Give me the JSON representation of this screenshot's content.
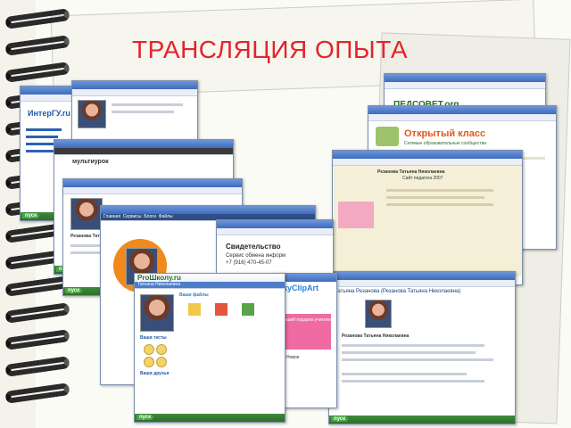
{
  "slide": {
    "title": "ТРАНСЛЯЦИЯ ОПЫТА"
  },
  "colors": {
    "title": "#e3242b",
    "taskbar": "#2c6d2a",
    "window_title": "#3d6bbf",
    "skyclip": "#2a7fd4",
    "open_class": "#e05a1c"
  },
  "screens": {
    "intergu": {
      "logo": "ИнтерГУ.ru",
      "start": "пуск"
    },
    "multiurok": {
      "logo": "мультиурок",
      "start": "пуск"
    },
    "profile": {
      "name": "Резанова Татьяна Николаевна",
      "start": "пуск",
      "menu": [
        "Главная",
        "Сервисы",
        "Блоги",
        "Файлы"
      ]
    },
    "svidetelstvo": {
      "heading": "Свидетельство",
      "sub": "Сервис обмена информ",
      "phone": "+7 (916) 470-45-07"
    },
    "proshkolu": {
      "logo": "ProШколу.ru",
      "heading": "Татьяна Николаевна",
      "files": "Ваши файлы",
      "tests": "Ваши тесты",
      "friends": "Ваши друзья",
      "start": "пуск"
    },
    "skyclip": {
      "logo": "SkyClipArt",
      "banner": "Лучший подарок учителю!",
      "title": "Новое"
    },
    "pedsovet": {
      "logo": "ПЕДСОВЕТ.org"
    },
    "open_class": {
      "logo": "Открытый класс",
      "subtitle": "Сетевые образовательные сообщества"
    },
    "rezanova_site": {
      "title": "Резанова Татьяна Николаевна",
      "subtitle": "Сайт педагога 2007"
    },
    "portfolio": {
      "title": "Татьяна Резанова (Резанова Татьяна Николаевна)",
      "name": "Резанова Татьяна Николаевна",
      "start": "пуск"
    }
  }
}
